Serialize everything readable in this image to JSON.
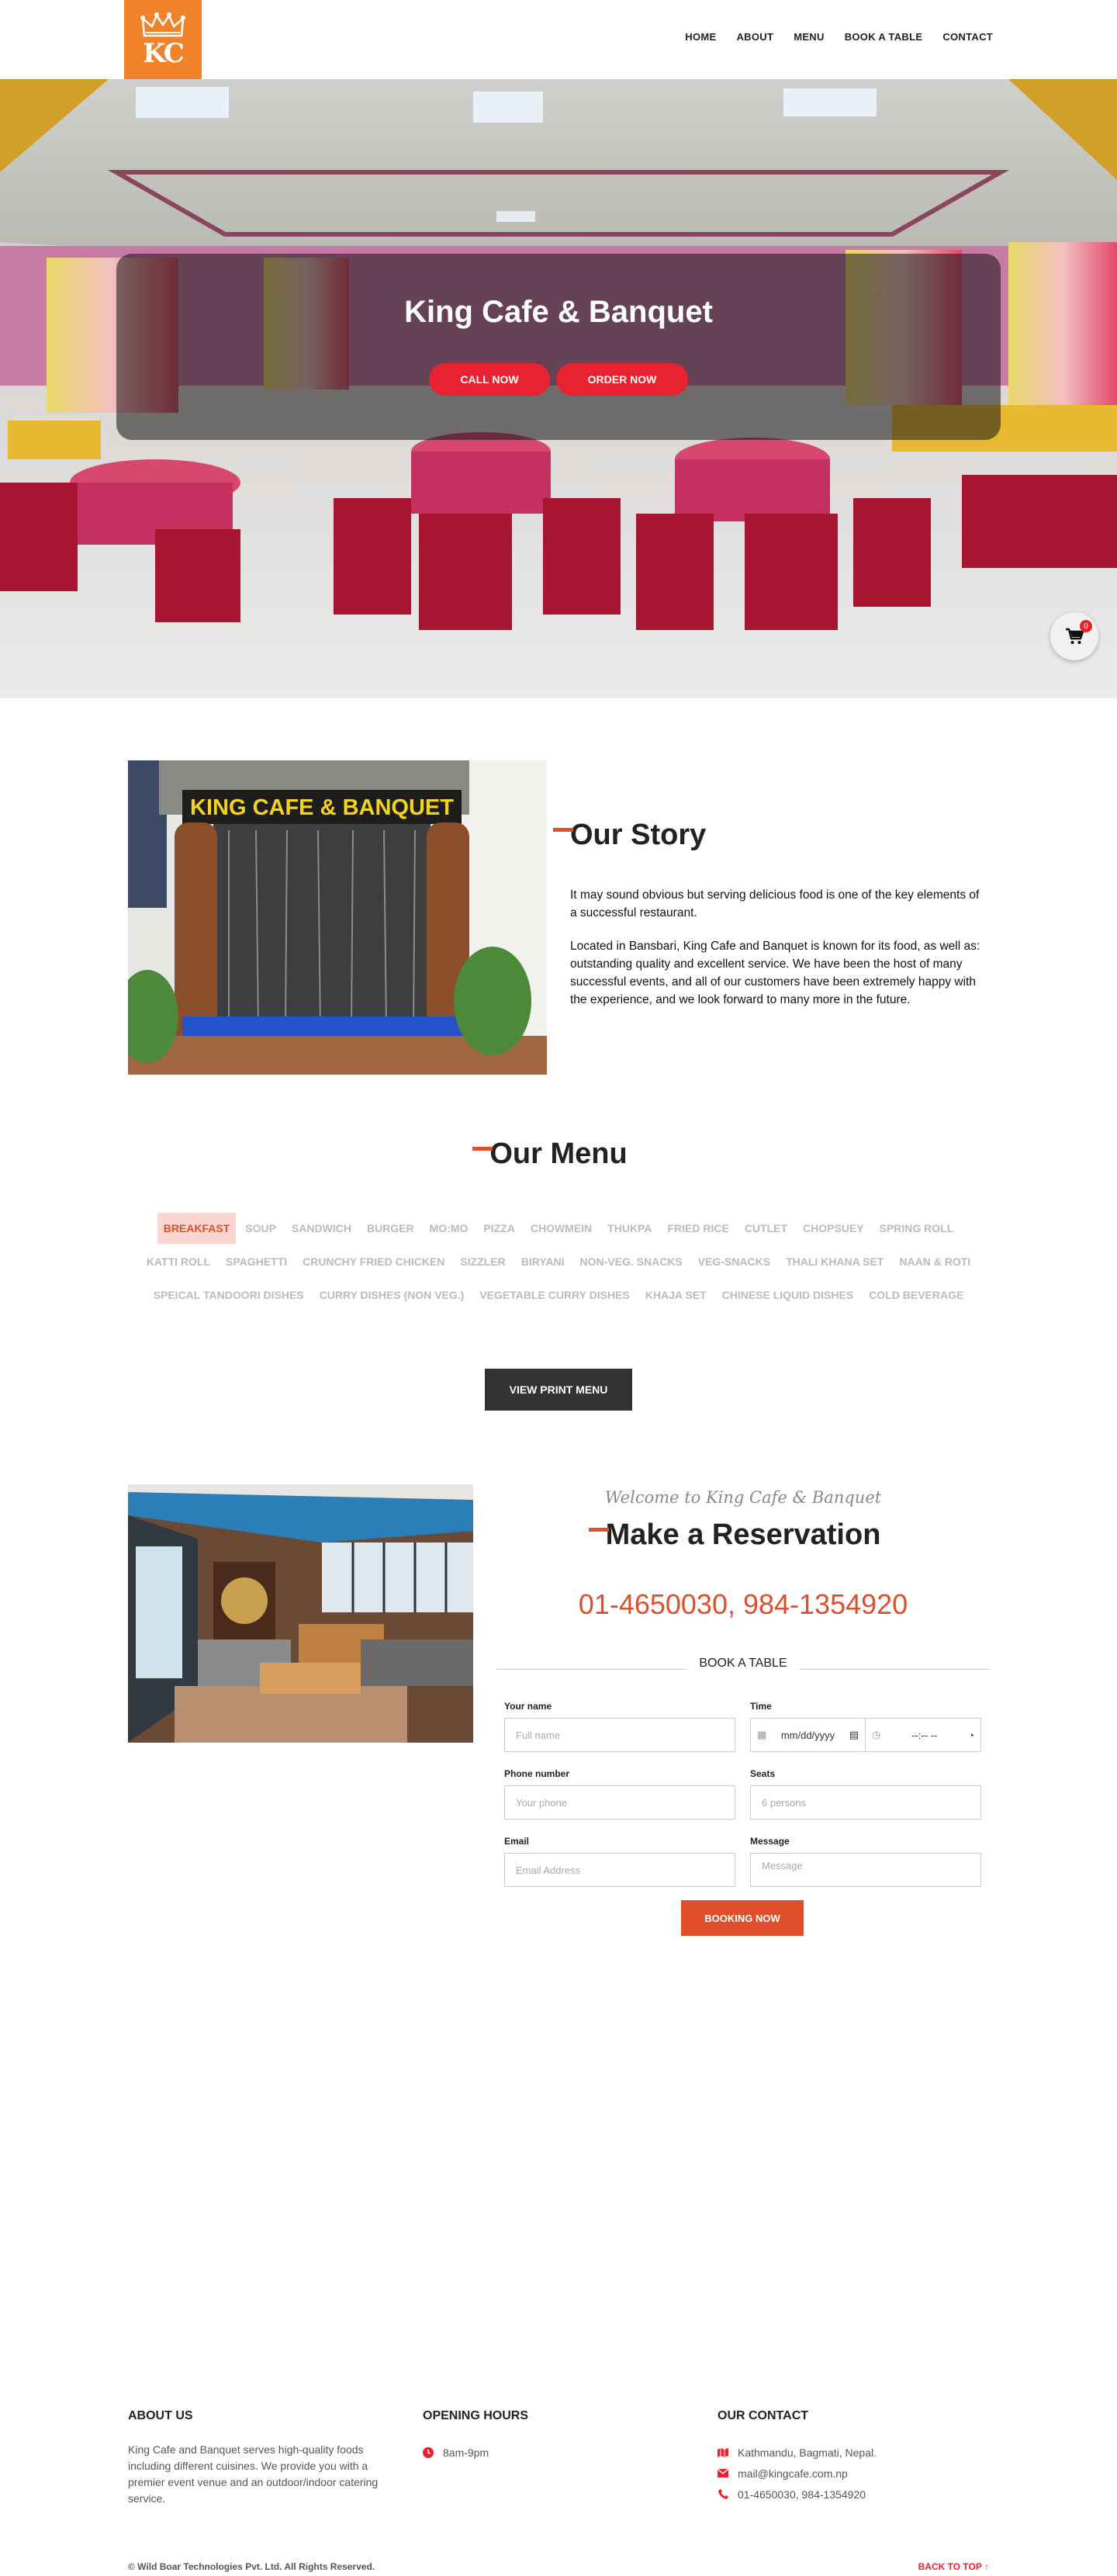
{
  "brand": {
    "monogram": "KC",
    "color": "#f0832a"
  },
  "nav": {
    "items": [
      "HOME",
      "ABOUT",
      "MENU",
      "BOOK A TABLE",
      "CONTACT"
    ]
  },
  "hero": {
    "title": "King Cafe & Banquet",
    "call_label": "CALL NOW",
    "order_label": "ORDER NOW",
    "cart_count": "0",
    "accent": "#e8232f"
  },
  "story": {
    "sign_text": "KING CAFE & BANQUET",
    "title": "Our Story",
    "p1": "It may sound obvious but serving delicious food is one of the key elements of a successful restaurant.",
    "p2": "Located in Bansbari, King Cafe and Banquet is known for its food, as well as: outstanding quality and excellent service. We have been the host of many successful events, and all of our customers have been extremely happy with the experience, and we look forward to many more in the future."
  },
  "menu": {
    "title": "Our Menu",
    "active_category": "BREAKFAST",
    "categories": [
      "BREAKFAST",
      "SOUP",
      "SANDWICH",
      "BURGER",
      "MO:MO",
      "PIZZA",
      "CHOWMEIN",
      "THUKPA",
      "FRIED RICE",
      "CUTLET",
      "CHOPSUEY",
      "SPRING ROLL",
      "KATTI ROLL",
      "SPAGHETTI",
      "CRUNCHY FRIED CHICKEN",
      "SIZZLER",
      "BIRYANI",
      "NON-VEG. SNACKS",
      "VEG-SNACKS",
      "THALI KHANA SET",
      "NAAN & ROTI",
      "SPEICAL TANDOORI DISHES",
      "CURRY DISHES (NON VEG.)",
      "VEGETABLE CURRY DISHES",
      "KHAJA SET",
      "CHINESE LIQUID DISHES",
      "COLD BEVERAGE"
    ],
    "print_label": "VIEW PRINT MENU"
  },
  "reservation": {
    "welcome": "Welcome to King Cafe & Banquet",
    "title": "Make a Reservation",
    "phone": "01-4650030, 984-1354920",
    "book_heading": "BOOK A TABLE",
    "name_label": "Your name",
    "name_placeholder": "Full name",
    "time_label": "Time",
    "date_placeholder": "mm/dd/yyyy",
    "time_placeholder": "--:-- --",
    "phone_label": "Phone number",
    "phone_placeholder": "Your phone",
    "seats_label": "Seats",
    "seats_value": "6 persons",
    "email_label": "Email",
    "email_placeholder": "Email Address",
    "message_label": "Message",
    "message_placeholder": "Message",
    "submit_label": "BOOKING NOW",
    "accent": "#e04e2b"
  },
  "footer": {
    "about_title": "ABOUT US",
    "about_text": "King Cafe and Banquet serves high-quality foods including different cuisines. We provide you with a premier event venue and an outdoor/indoor catering service.",
    "hours_title": "OPENING HOURS",
    "hours": "8am-9pm",
    "contact_title": "OUR CONTACT",
    "address": "Kathmandu, Bagmati, Nepal.",
    "email": "mail@kingcafe.com.np",
    "phone": "01-4650030, 984-1354920",
    "copyright": "© Wild Boar Technologies Pvt. Ltd. All Rights Reserved.",
    "back_top": "BACK TO TOP ↑"
  }
}
